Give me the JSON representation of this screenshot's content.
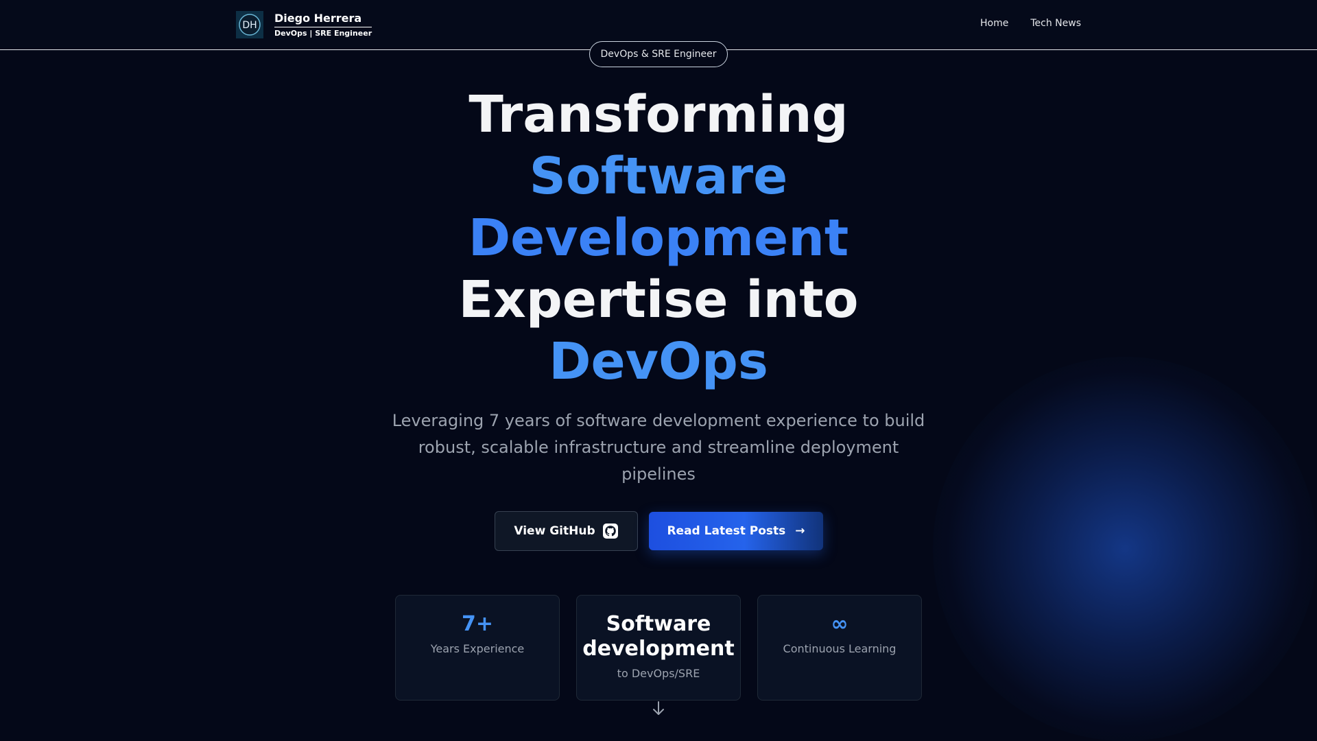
{
  "header": {
    "brand_name": "Diego Herrera",
    "brand_subtitle": "DevOps | SRE Engineer",
    "logo_letters": "DH",
    "nav": [
      {
        "label": "Home"
      },
      {
        "label": "Tech News"
      }
    ]
  },
  "hero": {
    "badge": "DevOps & SRE Engineer",
    "headline": {
      "line1": "Transforming",
      "line2": "Software",
      "line3": "Development",
      "line4": "Expertise into",
      "line5": "DevOps"
    },
    "subtitle": "Leveraging 7 years of software development experience to build robust, scalable infrastructure and streamline deployment pipelines",
    "buttons": {
      "github_label": "View GitHub",
      "posts_label": "Read Latest Posts",
      "posts_arrow": "→"
    }
  },
  "stats": [
    {
      "value": "7+",
      "label": "Years Experience"
    },
    {
      "value": "Software development",
      "label": "to DevOps/SRE"
    },
    {
      "value": "∞",
      "label": "Continuous Learning"
    }
  ],
  "icons": {
    "github": "github-icon",
    "scroll": "arrow-down-icon"
  },
  "colors": {
    "background": "#040818",
    "accent_blue": "#3b82f6",
    "button_primary": "#2563eb"
  }
}
